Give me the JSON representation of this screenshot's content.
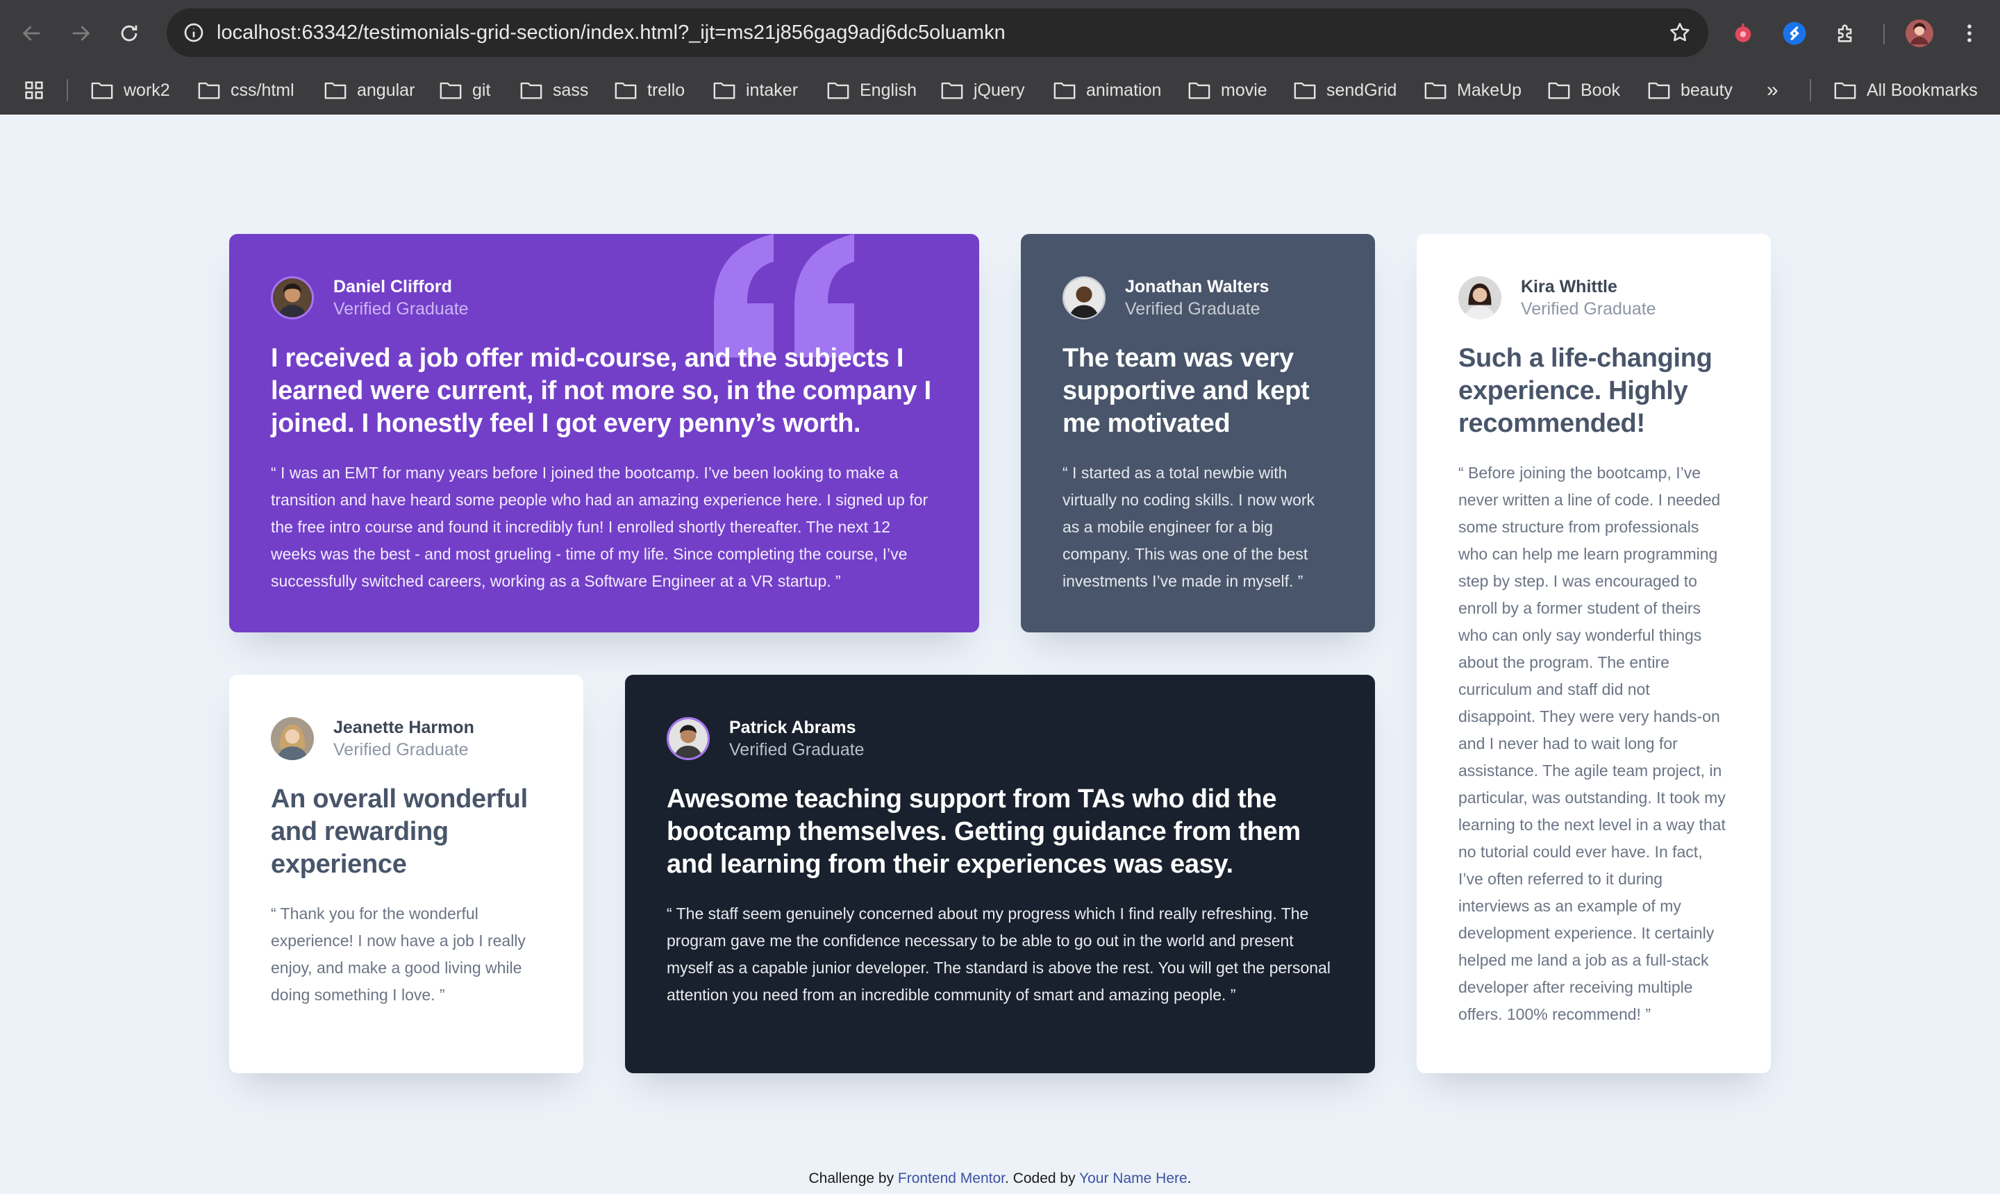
{
  "browser": {
    "url": "localhost:63342/testimonials-grid-section/index.html?_ijt=ms21j856gag9adj6dc5oluamkn",
    "bookmarks": [
      "work2",
      "css/html",
      "angular",
      "git",
      "sass",
      "trello",
      "intaker",
      "English",
      "jQuery",
      "animation",
      "movie",
      "sendGrid",
      "MakeUp",
      "Book",
      "beauty"
    ],
    "more_bookmarks": "»",
    "all_bookmarks": "All Bookmarks"
  },
  "testimonials": [
    {
      "name": "Daniel Clifford",
      "role": "Verified Graduate",
      "headline": "I received a job offer mid-course, and the subjects I learned were current, if not more so, in the company I joined. I honestly feel I got every penny’s worth.",
      "body": "“ I was an EMT for many years before I joined the bootcamp. I’ve been looking to make a transition and have heard some people who had an amazing experience here. I signed up for the free intro course and found it incredibly fun! I enrolled shortly thereafter. The next 12 weeks was the best - and most grueling - time of my life. Since completing the course, I’ve successfully switched careers, working as a Software Engineer at a VR startup. ”"
    },
    {
      "name": "Jonathan Walters",
      "role": "Verified Graduate",
      "headline": "The team was very supportive and kept me motivated",
      "body": "“ I started as a total newbie with virtually no coding skills. I now work as a mobile engineer for a big company. This was one of the best investments I’ve made in myself. ”"
    },
    {
      "name": "Kira Whittle",
      "role": "Verified Graduate",
      "headline": "Such a life-changing experience. Highly recommended!",
      "body": "“ Before joining the bootcamp, I’ve never written a line of code. I needed some structure from professionals who can help me learn programming step by step. I was encouraged to enroll by a former student of theirs who can only say wonderful things about the program. The entire curriculum and staff did not disappoint. They were very hands-on and I never had to wait long for assistance. The agile team project, in particular, was outstanding. It took my learning to the next level in a way that no tutorial could ever have. In fact, I’ve often referred to it during interviews as an example of my development experience. It certainly helped me land a job as a full-stack developer after receiving multiple offers. 100% recommend! ”"
    },
    {
      "name": "Jeanette Harmon",
      "role": "Verified Graduate",
      "headline": "An overall wonderful and rewarding experience",
      "body": "“ Thank you for the wonderful experience! I now have a job I really enjoy, and make a good living while doing something I love. ”"
    },
    {
      "name": "Patrick Abrams",
      "role": "Verified Graduate",
      "headline": "Awesome teaching support from TAs who did the bootcamp themselves. Getting guidance from them and learning from their experiences was easy.",
      "body": "“ The staff seem genuinely concerned about my progress which I find really refreshing. The program gave me the confidence necessary to be able to go out in the world and present myself as a capable junior developer. The standard is above the rest. You will get the personal attention you need from an incredible community of smart and amazing people. ”"
    }
  ],
  "footer": {
    "prefix": "Challenge by ",
    "link1": "Frontend Mentor",
    "middle": ". Coded by ",
    "link2": "Your Name Here",
    "suffix": "."
  }
}
